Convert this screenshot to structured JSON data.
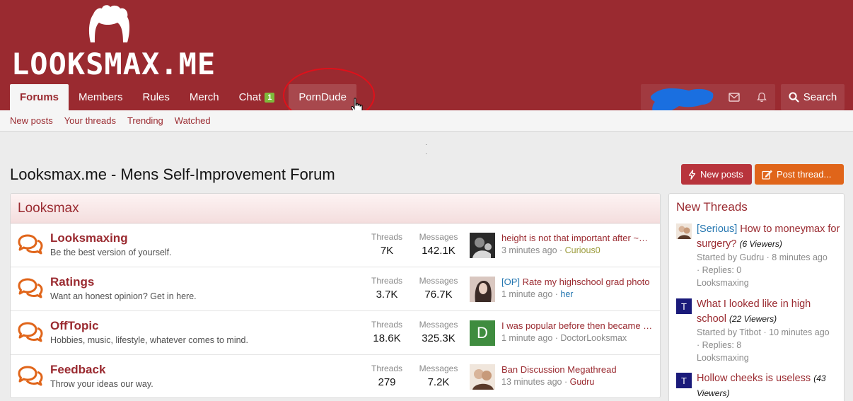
{
  "header": {
    "logo_text": "LOOKSMAX.ME",
    "nav": [
      {
        "label": "Forums"
      },
      {
        "label": "Members"
      },
      {
        "label": "Rules"
      },
      {
        "label": "Merch"
      },
      {
        "label": "Chat",
        "badge": "1"
      },
      {
        "label": "PornDude"
      }
    ],
    "search_label": "Search"
  },
  "subnav": [
    "New posts",
    "Your threads",
    "Trending",
    "Watched"
  ],
  "page": {
    "title": "Looksmax.me - Mens Self-Improvement Forum",
    "new_posts_label": "New posts",
    "post_thread_label": "Post thread..."
  },
  "forum": {
    "category": "Looksmax",
    "threads_label": "Threads",
    "messages_label": "Messages",
    "nodes": [
      {
        "title": "Looksmaxing",
        "desc": "Be the best version of yourself.",
        "threads": "7K",
        "messages": "142.1K",
        "latest_title": "height is not that important after ~…",
        "latest_time": "3 minutes ago",
        "latest_user": "Curious0",
        "user_color": "#9a9a3a"
      },
      {
        "title": "Ratings",
        "desc": "Want an honest opinion? Get in here.",
        "threads": "3.7K",
        "messages": "76.7K",
        "latest_prefix": "[OP]",
        "latest_title": "Rate my highschool grad photo",
        "latest_time": "1 minute ago",
        "latest_user": "her",
        "user_color": "#2577b1"
      },
      {
        "title": "OffTopic",
        "desc": "Hobbies, music, lifestyle, whatever comes to mind.",
        "threads": "18.6K",
        "messages": "325.3K",
        "latest_title": "I was popular before then became …",
        "latest_time": "1 minute ago",
        "latest_user": "DoctorLooksmax",
        "user_color": "#8a8a8a",
        "avatar_letter": "D"
      },
      {
        "title": "Feedback",
        "desc": "Throw your ideas our way.",
        "threads": "279",
        "messages": "7.2K",
        "latest_title": "Ban Discussion Megathread",
        "latest_time": "13 minutes ago",
        "latest_user": "Gudru",
        "user_color": "#9a2a30"
      }
    ]
  },
  "sidebar": {
    "heading": "New Threads",
    "items": [
      {
        "prefix": "[Serious]",
        "title": "How to moneymax for surgery?",
        "viewers": "(6 Viewers)",
        "started": "Started by Gudru · 8 minutes ago",
        "replies": "· Replies: 0",
        "forum": "Looksmaxing"
      },
      {
        "title": "What I looked like in high school",
        "viewers": "(22 Viewers)",
        "started": "Started by Titbot · 10 minutes ago",
        "replies": "· Replies: 8",
        "forum": "Looksmaxing",
        "avatar_letter": "T"
      },
      {
        "title": "Hollow cheeks is useless",
        "viewers": "(43 Viewers)",
        "avatar_letter": "T"
      }
    ]
  },
  "colors": {
    "brand": "#9a2a30",
    "accent_orange": "#e0651a",
    "badge_green": "#7fba3c"
  }
}
